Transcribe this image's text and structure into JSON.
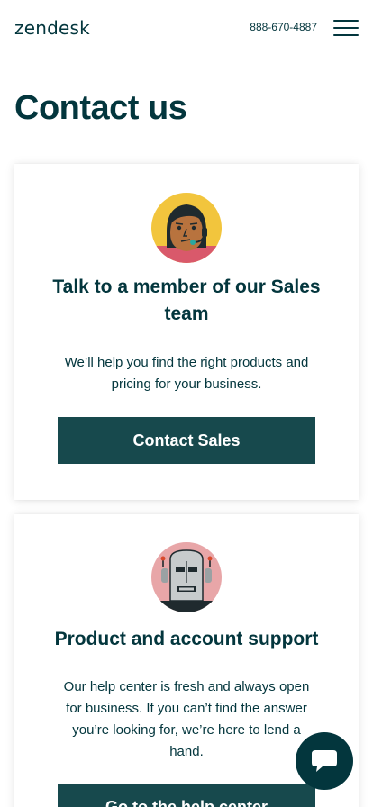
{
  "header": {
    "logo_text": "zendesk",
    "phone": "888-670-4887",
    "menu_icon": "hamburger-menu-icon"
  },
  "page": {
    "title": "Contact us"
  },
  "cards": [
    {
      "avatar_icon": "sales-agent-headset-avatar-icon",
      "title": "Talk to a member of our Sales team",
      "description": "We’ll help you find the right products and pricing for your business.",
      "button_label": "Contact Sales"
    },
    {
      "avatar_icon": "robot-support-avatar-icon",
      "title": "Product and account support",
      "description": "Our help center is fresh and always open for business. If you can’t find the answer you’re looking for, we’re here to lend a hand.",
      "button_label": "Go to the help center"
    }
  ],
  "chat": {
    "icon": "chat-bubble-icon"
  },
  "colors": {
    "brand_dark": "#03363d",
    "button_bg": "#17494d",
    "avatar_yellow": "#f2c53d",
    "avatar_pink": "#e8a6a8"
  }
}
